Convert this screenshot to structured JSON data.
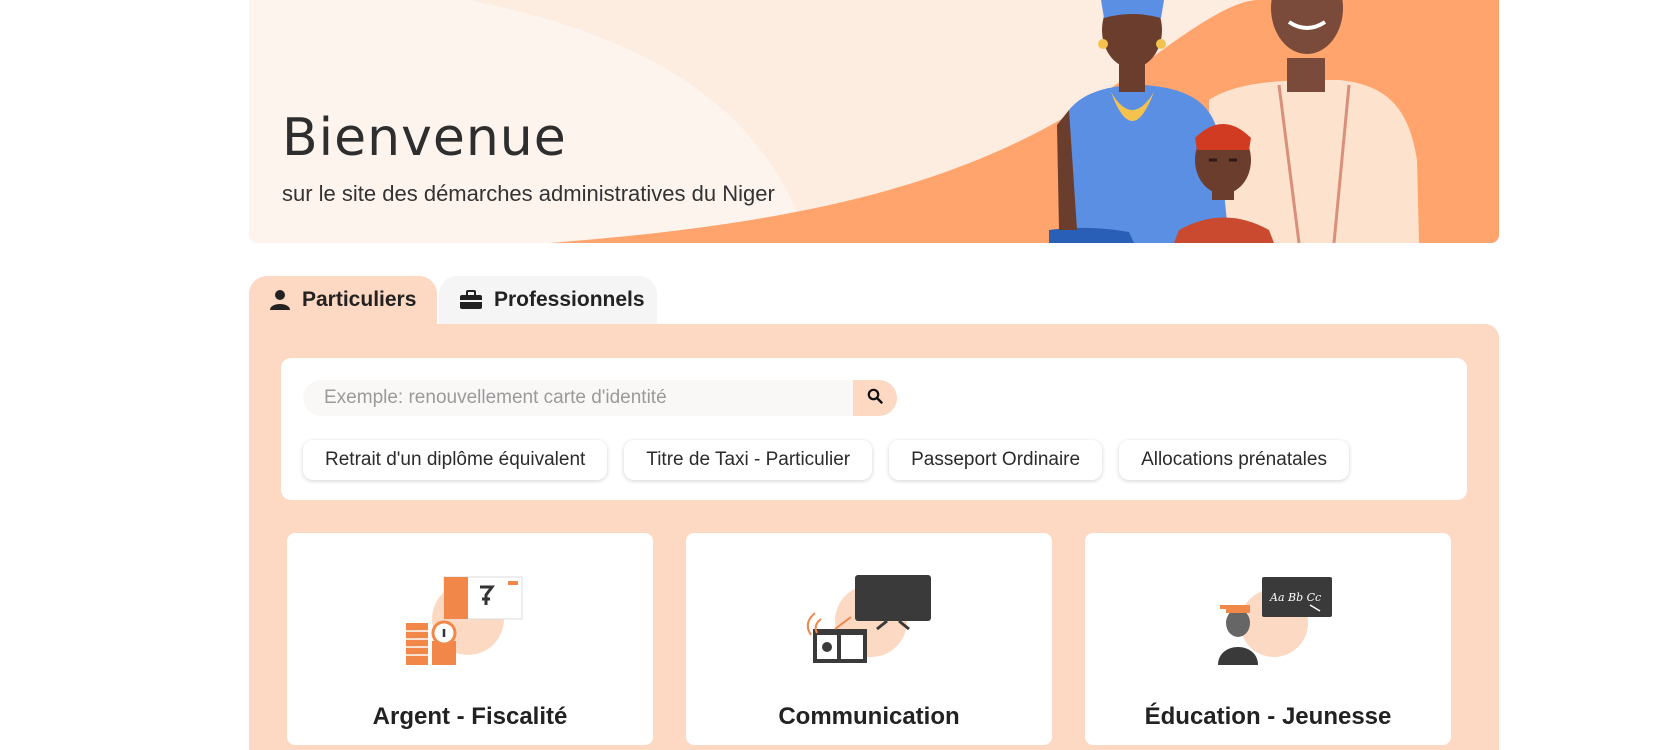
{
  "hero": {
    "title": "Bienvenue",
    "subtitle": "sur le site des démarches administratives du Niger"
  },
  "tabs": [
    {
      "label": "Particuliers",
      "icon": "person-icon",
      "active": true
    },
    {
      "label": "Professionnels",
      "icon": "briefcase-icon",
      "active": false
    }
  ],
  "search": {
    "placeholder": "Exemple: renouvellement carte d'identité",
    "value": ""
  },
  "suggestions": [
    "Retrait d'un diplôme équivalent",
    "Titre de Taxi - Particulier",
    "Passeport Ordinaire",
    "Allocations prénatales"
  ],
  "categories": [
    {
      "label": "Argent - Fiscalité",
      "icon": "money-tax-icon"
    },
    {
      "label": "Communication",
      "icon": "tv-radio-icon"
    },
    {
      "label": "Éducation - Jeunesse",
      "icon": "teacher-blackboard-icon"
    }
  ],
  "colors": {
    "accent_light": "#fdd8c2",
    "accent_orange": "#ffa46c",
    "hero_bg": "#fdece0"
  }
}
